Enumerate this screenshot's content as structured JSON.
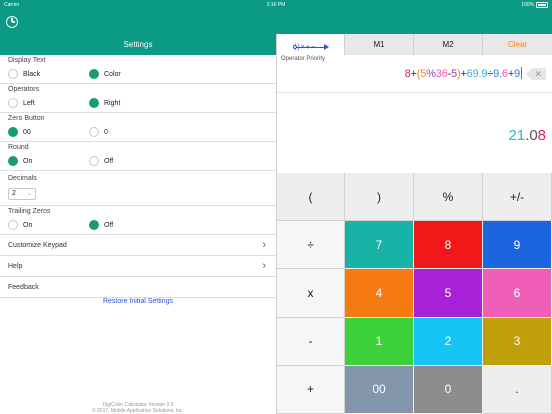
{
  "status_bar": {
    "carrier": "Carrier",
    "time": "2:16 PM",
    "battery": "100%"
  },
  "settings": {
    "title": "Settings",
    "display_text": {
      "label": "Display Text",
      "options": [
        "Black",
        "Color"
      ],
      "selected": "Color"
    },
    "operators": {
      "label": "Operators",
      "options": [
        "Left",
        "Right"
      ],
      "selected": "Right"
    },
    "zero_button": {
      "label": "Zero Button",
      "options": [
        "00",
        "0"
      ],
      "selected": "00"
    },
    "round": {
      "label": "Round",
      "options": [
        "On",
        "Off"
      ],
      "selected": "On"
    },
    "decimals": {
      "label": "Decimals",
      "value": "2"
    },
    "trailing_zeros": {
      "label": "Trailing Zeros",
      "options": [
        "On",
        "Off"
      ],
      "selected": "Off"
    },
    "customize_keypad": "Customize Keypad",
    "help": "Help",
    "feedback": "Feedback",
    "restore": "Restore Initial Settings",
    "version_line1": "DigiColor Calculator Version 2.0",
    "version_line2": "© 2017, Mobile Application Solutions, Inc."
  },
  "calculator": {
    "priority_symbols": "()×+−",
    "m1": "M1",
    "m2": "M2",
    "clear": "Clear",
    "operator_priority_label": "Operator Priority",
    "expression_tokens": [
      {
        "t": "8",
        "c": "#e0245e"
      },
      {
        "t": "+",
        "c": "#333333"
      },
      {
        "t": "(",
        "c": "#f08a1c"
      },
      {
        "t": "5",
        "c": "#f08a1c"
      },
      {
        "t": "%",
        "c": "#8e44ad"
      },
      {
        "t": "36",
        "c": "#e95ca8"
      },
      {
        "t": "-",
        "c": "#333333"
      },
      {
        "t": "5",
        "c": "#8e44ad"
      },
      {
        "t": ")",
        "c": "#f08a1c"
      },
      {
        "t": "+",
        "c": "#333333"
      },
      {
        "t": "69",
        "c": "#2fb8c4"
      },
      {
        "t": ".",
        "c": "#2fb8c4"
      },
      {
        "t": "9",
        "c": "#2fb8c4"
      },
      {
        "t": "÷",
        "c": "#333333"
      },
      {
        "t": "9",
        "c": "#2a7be0"
      },
      {
        "t": ".",
        "c": "#2a7be0"
      },
      {
        "t": "6",
        "c": "#e95ca8"
      },
      {
        "t": "+",
        "c": "#333333"
      },
      {
        "t": "9",
        "c": "#2a7be0"
      }
    ],
    "result_tokens": [
      {
        "t": "21",
        "c": "#2fb8c4"
      },
      {
        "t": ".",
        "c": "#555555"
      },
      {
        "t": "0",
        "c": "#555555"
      },
      {
        "t": "8",
        "c": "#e0245e"
      }
    ],
    "keys": [
      {
        "label": "(",
        "name": "key-open-paren",
        "type": "fn"
      },
      {
        "label": ")",
        "name": "key-close-paren",
        "type": "fn"
      },
      {
        "label": "%",
        "name": "key-percent",
        "type": "fn"
      },
      {
        "label": "+/-",
        "name": "key-plus-minus",
        "type": "fn"
      },
      {
        "label": "÷",
        "name": "key-divide",
        "type": "op"
      },
      {
        "label": "7",
        "name": "key-7",
        "bg": "#18b3a8",
        "type": "col"
      },
      {
        "label": "8",
        "name": "key-8",
        "bg": "#f01818",
        "type": "col"
      },
      {
        "label": "9",
        "name": "key-9",
        "bg": "#1b66e0",
        "type": "col"
      },
      {
        "label": "x",
        "name": "key-multiply",
        "type": "op"
      },
      {
        "label": "4",
        "name": "key-4",
        "bg": "#f57b10",
        "type": "col"
      },
      {
        "label": "5",
        "name": "key-5",
        "bg": "#a921d6",
        "type": "col"
      },
      {
        "label": "6",
        "name": "key-6",
        "bg": "#ef5fb8",
        "type": "col"
      },
      {
        "label": "-",
        "name": "key-minus",
        "type": "op"
      },
      {
        "label": "1",
        "name": "key-1",
        "bg": "#3ed23a",
        "type": "col"
      },
      {
        "label": "2",
        "name": "key-2",
        "bg": "#15c4f2",
        "type": "col"
      },
      {
        "label": "3",
        "name": "key-3",
        "bg": "#bfa00a",
        "type": "col"
      },
      {
        "label": "+",
        "name": "key-plus",
        "type": "op"
      },
      {
        "label": "00",
        "name": "key-double-zero",
        "bg": "#8496ab",
        "type": "col"
      },
      {
        "label": "0",
        "name": "key-0",
        "bg": "#8d8d8d",
        "type": "col"
      },
      {
        "label": ".",
        "name": "key-decimal",
        "type": "fn"
      },
      {
        "label": "=",
        "name": "key-equals",
        "type": "op"
      }
    ]
  },
  "colors": {
    "primary": "#0a9a86",
    "radio_on": "#1a9a78",
    "link": "#2a50d8",
    "clear": "#e98b1f"
  }
}
